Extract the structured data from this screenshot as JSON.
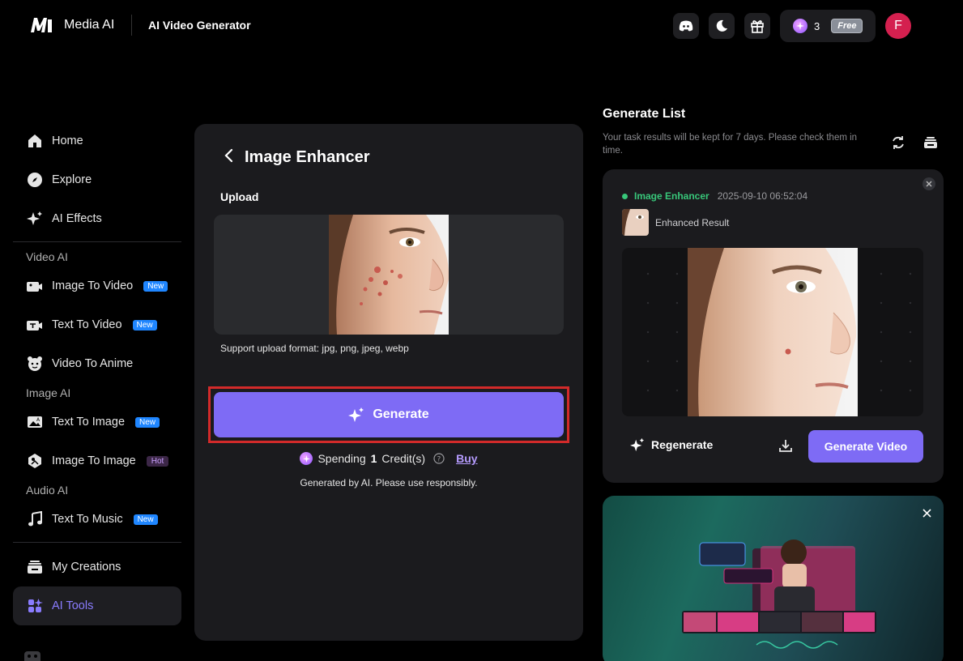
{
  "header": {
    "brand": "Media AI",
    "page_name": "AI Video Generator",
    "credits": "3",
    "plan_badge": "Free",
    "avatar_letter": "F"
  },
  "sidebar": {
    "items_top": [
      {
        "label": "Home",
        "icon": "home-icon"
      },
      {
        "label": "Explore",
        "icon": "compass-icon"
      },
      {
        "label": "AI Effects",
        "icon": "sparkle-icon"
      }
    ],
    "video_section": "Video AI",
    "video_items": [
      {
        "label": "Image To Video",
        "badge": "New"
      },
      {
        "label": "Text To Video",
        "badge": "New"
      },
      {
        "label": "Video To Anime",
        "badge": ""
      }
    ],
    "image_section": "Image AI",
    "image_items": [
      {
        "label": "Text To Image",
        "badge": "New"
      },
      {
        "label": "Image To Image",
        "badge": "Hot"
      }
    ],
    "audio_section": "Audio AI",
    "audio_items": [
      {
        "label": "Text To Music",
        "badge": "New"
      }
    ],
    "bottom_items": [
      {
        "label": "My Creations"
      },
      {
        "label": "AI Tools"
      }
    ]
  },
  "panel": {
    "title": "Image Enhancer",
    "upload_label": "Upload",
    "format_note": "Support upload format: jpg, png, jpeg, webp",
    "generate_label": "Generate",
    "spending_prefix": "Spending",
    "spending_amount": "1",
    "spending_suffix": "Credit(s)",
    "buy_label": "Buy",
    "ai_note": "Generated by AI. Please use responsibly."
  },
  "generate_list": {
    "title": "Generate List",
    "subtitle": "Your task results will be kept for 7 days. Please check them in time.",
    "task": {
      "name": "Image Enhancer",
      "timestamp": "2025-09-10 06:52:04",
      "result_label": "Enhanced Result"
    },
    "regenerate_label": "Regenerate",
    "generate_video_label": "Generate Video"
  },
  "colors": {
    "accent": "#7e6bf5",
    "success": "#38c77a",
    "highlight_outline": "#d22a2a"
  }
}
